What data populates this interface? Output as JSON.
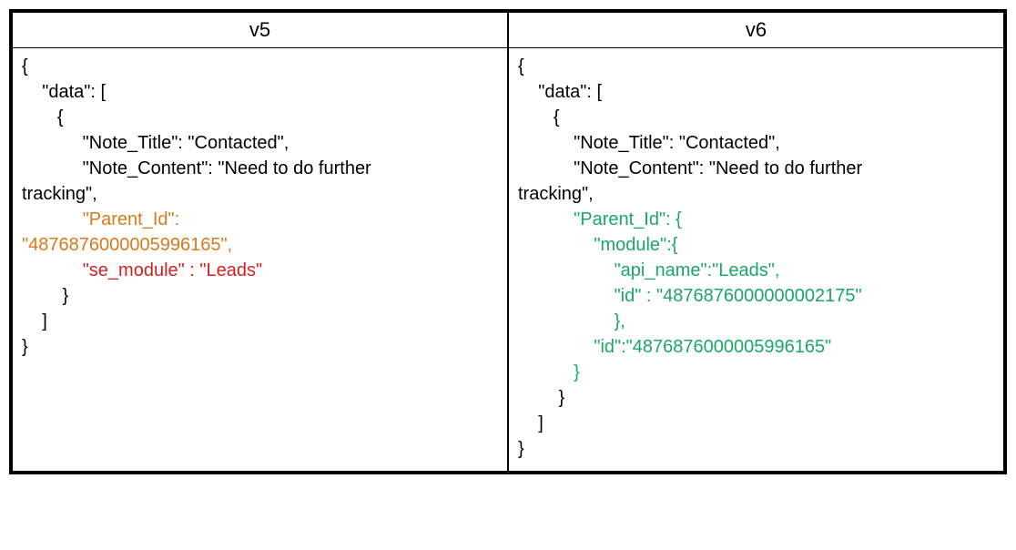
{
  "headers": {
    "left": "v5",
    "right": "v6"
  },
  "v5": {
    "l1": "{",
    "l2": "    \"data\": [",
    "l3": "       {",
    "l4": "            \"Note_Title\": \"Contacted\",",
    "l5": "            \"Note_Content\": \"Need to do further",
    "l6": "tracking\",",
    "l7a": "            ",
    "l7b": "\"Parent_Id\":",
    "l8a": "\"4876876000005996165\",",
    "l9a": "            ",
    "l9b": "\"se_module\" : \"Leads\"",
    "l10": "        }",
    "l11": "    ]",
    "l12": "}"
  },
  "v6": {
    "l1": "{",
    "l2": "    \"data\": [",
    "l3": "       {",
    "l4": "           \"Note_Title\": \"Contacted\",",
    "l5": "           \"Note_Content\": \"Need to do further",
    "l6": "tracking\",",
    "l7a": "           ",
    "l7b": "\"Parent_Id\": {",
    "l8a": "               ",
    "l8b": "\"module\":{",
    "l9a": "                   ",
    "l9b": "\"api_name\":\"Leads\",",
    "l10a": "                   ",
    "l10b": "\"id\" : \"4876876000000002175\"",
    "l11a": "                   ",
    "l11b": "},",
    "l12a": "               ",
    "l12b": "\"id\":\"4876876000005996165\"",
    "l13a": "           ",
    "l13b": "}",
    "l14": "        }",
    "l15": "    ]",
    "l16": "}"
  }
}
